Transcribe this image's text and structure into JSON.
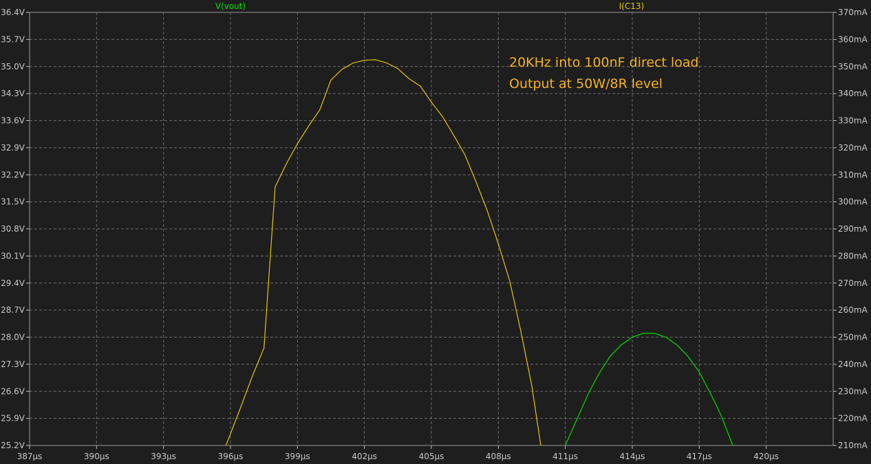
{
  "annotation": {
    "line1": "20KHz into 100nF direct load",
    "line2": "Output at 50W/8R level"
  },
  "chart_data": {
    "type": "line",
    "grid": true,
    "xaxis": {
      "range": [
        387,
        423
      ],
      "ticks": [
        387,
        390,
        393,
        396,
        399,
        402,
        405,
        408,
        411,
        414,
        417,
        420
      ],
      "tick_labels": [
        "387µs",
        "390µs",
        "393µs",
        "396µs",
        "399µs",
        "402µs",
        "405µs",
        "408µs",
        "411µs",
        "414µs",
        "417µs",
        "420µs"
      ]
    },
    "yaxis_left": {
      "range": [
        25.2,
        36.4
      ],
      "ticks": [
        36.4,
        35.7,
        35.0,
        34.3,
        33.6,
        32.9,
        32.2,
        31.5,
        30.8,
        30.1,
        29.4,
        28.7,
        28.0,
        27.3,
        26.6,
        25.9,
        25.2
      ],
      "tick_labels": [
        "36.4V",
        "35.7V",
        "35.0V",
        "34.3V",
        "33.6V",
        "32.9V",
        "32.2V",
        "31.5V",
        "30.8V",
        "30.1V",
        "29.4V",
        "28.7V",
        "28.0V",
        "27.3V",
        "26.6V",
        "25.9V",
        "25.2V"
      ]
    },
    "yaxis_right": {
      "range": [
        210,
        370
      ],
      "ticks": [
        370,
        360,
        350,
        340,
        330,
        320,
        310,
        300,
        290,
        280,
        270,
        260,
        250,
        240,
        230,
        220,
        210
      ],
      "tick_labels": [
        "370mA",
        "360mA",
        "350mA",
        "340mA",
        "330mA",
        "320mA",
        "310mA",
        "300mA",
        "290mA",
        "280mA",
        "270mA",
        "260mA",
        "250mA",
        "240mA",
        "230mA",
        "220mA",
        "210mA"
      ]
    },
    "series": [
      {
        "name": "V(vout)",
        "axis": "left",
        "color": "#00e000",
        "x": [
          411.0,
          411.5,
          412.0,
          412.5,
          413.0,
          413.5,
          414.0,
          414.5,
          415.0,
          415.5,
          416.0,
          416.5,
          417.0,
          417.5,
          418.0,
          418.5
        ],
        "y": [
          25.2,
          25.85,
          26.5,
          27.05,
          27.5,
          27.8,
          28.0,
          28.1,
          28.1,
          28.0,
          27.8,
          27.5,
          27.1,
          26.55,
          25.95,
          25.2
        ]
      },
      {
        "name": "I(C13)",
        "axis": "right",
        "color": "#e6c800",
        "x": [
          395.8,
          396.5,
          397.0,
          397.5,
          398.0,
          398.5,
          399.0,
          399.5,
          400.0,
          400.5,
          401.0,
          401.5,
          402.0,
          402.5,
          403.0,
          403.5,
          404.0,
          404.5,
          405.0,
          405.5,
          406.0,
          406.5,
          407.0,
          407.5,
          408.0,
          408.5,
          409.0,
          409.5,
          409.9
        ],
        "y": [
          210.0,
          225.0,
          236.0,
          246.0,
          305.5,
          314.0,
          321.5,
          328.0,
          334.0,
          345.0,
          349.0,
          351.3,
          352.3,
          352.5,
          351.3,
          349.2,
          345.5,
          342.8,
          336.8,
          331.5,
          324.6,
          317.4,
          307.4,
          296.8,
          284.5,
          271.0,
          252.5,
          232.0,
          210.0
        ]
      }
    ]
  }
}
